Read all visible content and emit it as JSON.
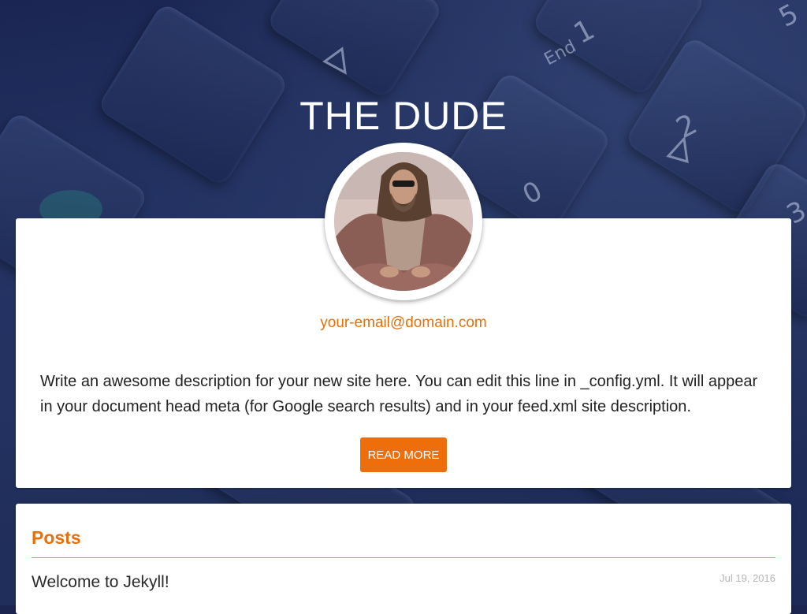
{
  "header": {
    "site_title": "THE DUDE"
  },
  "profile": {
    "avatar_icon": "avatar-photo",
    "email": "your-email@domain.com",
    "description": "Write an awesome description for your new site here. You can edit this line in _config.yml. It will appear in your document head meta (for Google search results) and in your feed.xml site description.",
    "read_more_label": "READ MORE"
  },
  "posts": {
    "heading": "Posts",
    "items": [
      {
        "title": "Welcome to Jekyll!",
        "date": "Jul 19, 2016"
      }
    ]
  },
  "background": {
    "key_glyphs": [
      "1",
      "End",
      "2",
      "0",
      "5",
      "3"
    ]
  },
  "colors": {
    "accent": "#ee6e0b",
    "link": "#e8700a",
    "background": "#1b2550",
    "card": "#ffffff"
  }
}
